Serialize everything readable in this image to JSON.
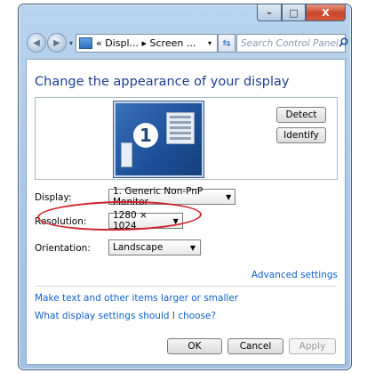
{
  "window": {
    "caption_buttons": {
      "minimize": "–",
      "maximize": "□",
      "close": "X"
    }
  },
  "toolbar": {
    "back_icon": "back-arrow-icon",
    "forward_icon": "forward-arrow-icon",
    "address_text": "« Displ... ▸ Screen ...",
    "address_dropdown": "▾",
    "refresh_glyph": "⇆",
    "search_placeholder": "Search Control Panel",
    "search_icon": "🔍"
  },
  "main": {
    "title": "Change the appearance of your display",
    "monitor_number": "1",
    "detect_label": "Detect",
    "identify_label": "Identify",
    "display_label": "Display:",
    "display_value": "1. Generic Non-PnP Monitor",
    "resolution_label": "Resolution:",
    "resolution_value": "1280 × 1024",
    "orientation_label": "Orientation:",
    "orientation_value": "Landscape",
    "advanced_link": "Advanced settings",
    "link_text_size": "Make text and other items larger or smaller",
    "link_help": "What display settings should I choose?",
    "ok_label": "OK",
    "cancel_label": "Cancel",
    "apply_label": "Apply"
  },
  "colors": {
    "title_blue": "#1e3e92",
    "link_blue": "#0f5fcc",
    "annotation_red": "#d0212a",
    "close_red": "#c7452b"
  }
}
